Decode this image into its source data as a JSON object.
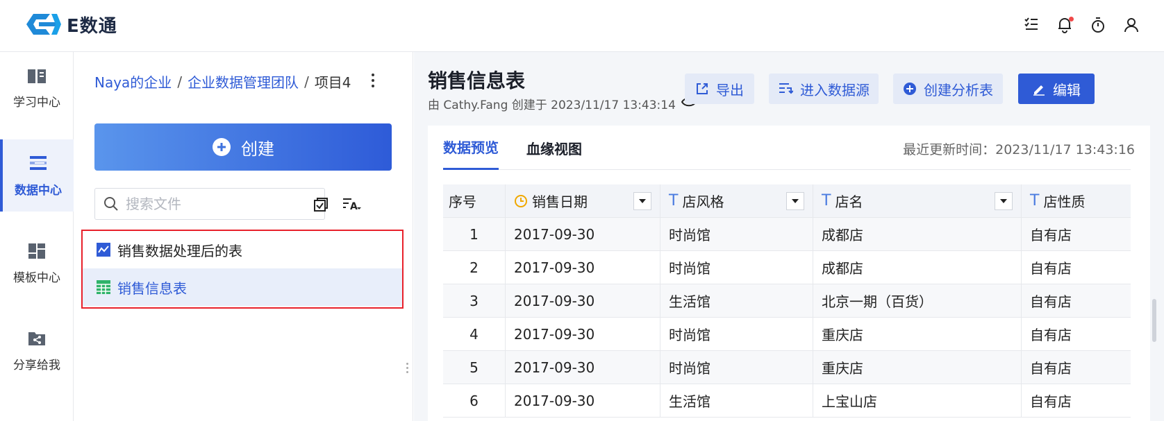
{
  "app": {
    "name": "E数通",
    "brand_color": "#2f5bd6"
  },
  "topbar": {
    "icons": [
      "tasks-icon",
      "bell-icon",
      "timer-icon",
      "user-icon"
    ]
  },
  "rail": {
    "items": [
      {
        "label": "学习中心",
        "icon": "book-icon",
        "active": false
      },
      {
        "label": "数据中心",
        "icon": "data-icon",
        "active": true
      },
      {
        "label": "模板中心",
        "icon": "template-icon",
        "active": false
      },
      {
        "label": "分享给我",
        "icon": "share-icon",
        "active": false
      }
    ]
  },
  "filepanel": {
    "breadcrumb": [
      "Naya的企业",
      "企业数据管理团队",
      "项目4"
    ],
    "create_label": "创建",
    "search_placeholder": "搜索文件",
    "files": [
      {
        "name": "销售数据处理后的表",
        "icon": "chart-file-icon",
        "selected": false
      },
      {
        "name": "销售信息表",
        "icon": "table-file-icon",
        "selected": true
      }
    ]
  },
  "main": {
    "title": "销售信息表",
    "subtitle": "由 Cathy.Fang 创建于 2023/11/17 13:43:14",
    "actions": {
      "export": "导出",
      "datasource": "进入数据源",
      "create_analysis": "创建分析表",
      "edit": "编辑"
    },
    "tabs": [
      "数据预览",
      "血缘视图"
    ],
    "update_time": "最近更新时间：2023/11/17 13:43:16",
    "table": {
      "columns": [
        "序号",
        "销售日期",
        "店风格",
        "店名",
        "店性质"
      ],
      "rows": [
        [
          "1",
          "2017-09-30",
          "时尚馆",
          "成都店",
          "自有店"
        ],
        [
          "2",
          "2017-09-30",
          "时尚馆",
          "成都店",
          "自有店"
        ],
        [
          "3",
          "2017-09-30",
          "生活馆",
          "北京一期（百货）",
          "自有店"
        ],
        [
          "4",
          "2017-09-30",
          "时尚馆",
          "重庆店",
          "自有店"
        ],
        [
          "5",
          "2017-09-30",
          "时尚馆",
          "重庆店",
          "自有店"
        ],
        [
          "6",
          "2017-09-30",
          "生活馆",
          "上宝山店",
          "自有店"
        ]
      ]
    }
  }
}
